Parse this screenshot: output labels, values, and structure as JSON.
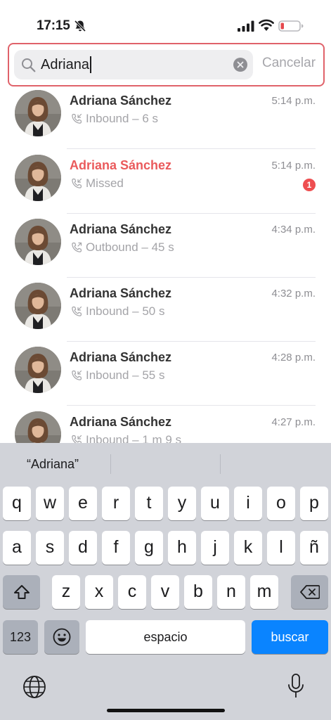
{
  "status_bar": {
    "time": "17:15"
  },
  "search": {
    "value": "Adriana",
    "cancel_label": "Cancelar"
  },
  "calls": [
    {
      "name": "Adriana Sánchez",
      "detail": "Inbound – 6 s",
      "time": "5:14 p.m.",
      "missed": false
    },
    {
      "name": "Adriana Sánchez",
      "detail": "Missed",
      "time": "5:14 p.m.",
      "missed": true,
      "badge": "1"
    },
    {
      "name": "Adriana Sánchez",
      "detail": "Outbound – 45 s",
      "time": "4:34 p.m.",
      "missed": false
    },
    {
      "name": "Adriana Sánchez",
      "detail": "Inbound – 50 s",
      "time": "4:32 p.m.",
      "missed": false
    },
    {
      "name": "Adriana Sánchez",
      "detail": "Inbound – 55 s",
      "time": "4:28 p.m.",
      "missed": false
    },
    {
      "name": "Adriana Sánchez",
      "detail": "Inbound – 1 m 9 s",
      "time": "4:27 p.m.",
      "missed": false
    }
  ],
  "keyboard": {
    "suggestion": "“Adriana”",
    "row1": [
      "q",
      "w",
      "e",
      "r",
      "t",
      "y",
      "u",
      "i",
      "o",
      "p"
    ],
    "row2": [
      "a",
      "s",
      "d",
      "f",
      "g",
      "h",
      "j",
      "k",
      "l",
      "ñ"
    ],
    "row3": [
      "z",
      "x",
      "c",
      "v",
      "b",
      "n",
      "m"
    ],
    "numbers_label": "123",
    "space_label": "espacio",
    "search_label": "buscar"
  },
  "colors": {
    "accent": "#0a84ff",
    "missed": "#ea5a5c",
    "badge": "#ee4e50",
    "highlight_border": "#e0626a"
  },
  "icons": [
    "bell-slash-icon",
    "signal-icon",
    "wifi-icon",
    "battery-icon",
    "search-icon",
    "clear-icon",
    "phone-icon",
    "shift-icon",
    "delete-icon",
    "emoji-icon",
    "globe-icon",
    "mic-icon"
  ]
}
